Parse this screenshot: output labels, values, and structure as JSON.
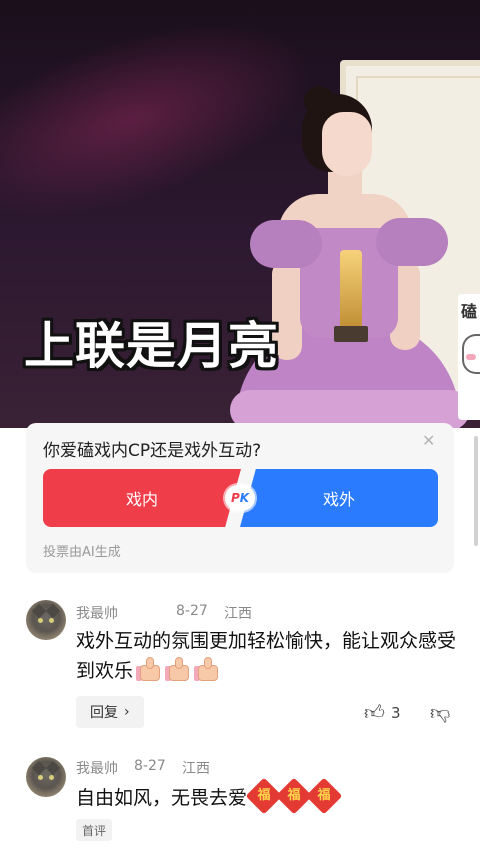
{
  "video": {
    "caption": "上联是月亮",
    "side_sticker_text": "磕"
  },
  "poll": {
    "question": "你爱磕戏内CP还是戏外互动?",
    "close_icon": "close-icon",
    "option_left": "戏内",
    "option_right": "戏外",
    "pk_p": "P",
    "pk_k": "K",
    "footnote": "投票由AI生成",
    "colors": {
      "left": "#f03d4a",
      "right": "#2b7bff"
    }
  },
  "comments": [
    {
      "username": "我最帅",
      "date": "8-27",
      "location": "江西",
      "text": "戏外互动的氛围更加轻松愉快，能让观众感受到欢乐",
      "emoji": "thumbs-up-icon",
      "reply_label": "回复",
      "reply_chevron": "›",
      "like_count": "3"
    },
    {
      "username": "我最帅",
      "date": "8-27",
      "location": "江西",
      "text": "自由如风，无畏去爱",
      "emoji_char": "福",
      "tag": "首评"
    }
  ]
}
